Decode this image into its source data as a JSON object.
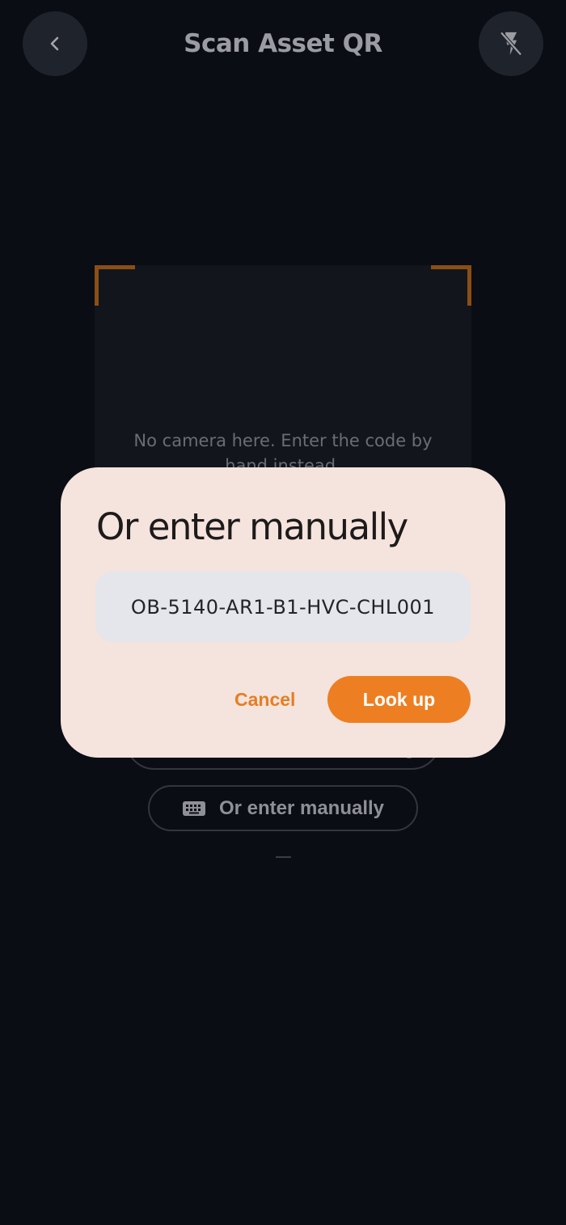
{
  "header": {
    "title": "Scan Asset QR",
    "back_icon": "chevron-left-icon",
    "flash_icon": "flash-off-icon"
  },
  "scanner": {
    "no_camera_text": "No camera here. Enter the code by hand instead."
  },
  "background_actions": {
    "manual_label": "Or enter manually",
    "manual_icon": "keyboard-icon"
  },
  "dialog": {
    "title": "Or enter manually",
    "code_value": "OB-5140-AR1-B1-HVC-CHL001",
    "cancel_label": "Cancel",
    "lookup_label": "Look up"
  },
  "colors": {
    "background": "#0a0d14",
    "accent": "#ed7f22",
    "dialog_surface": "#f5e3dd"
  }
}
